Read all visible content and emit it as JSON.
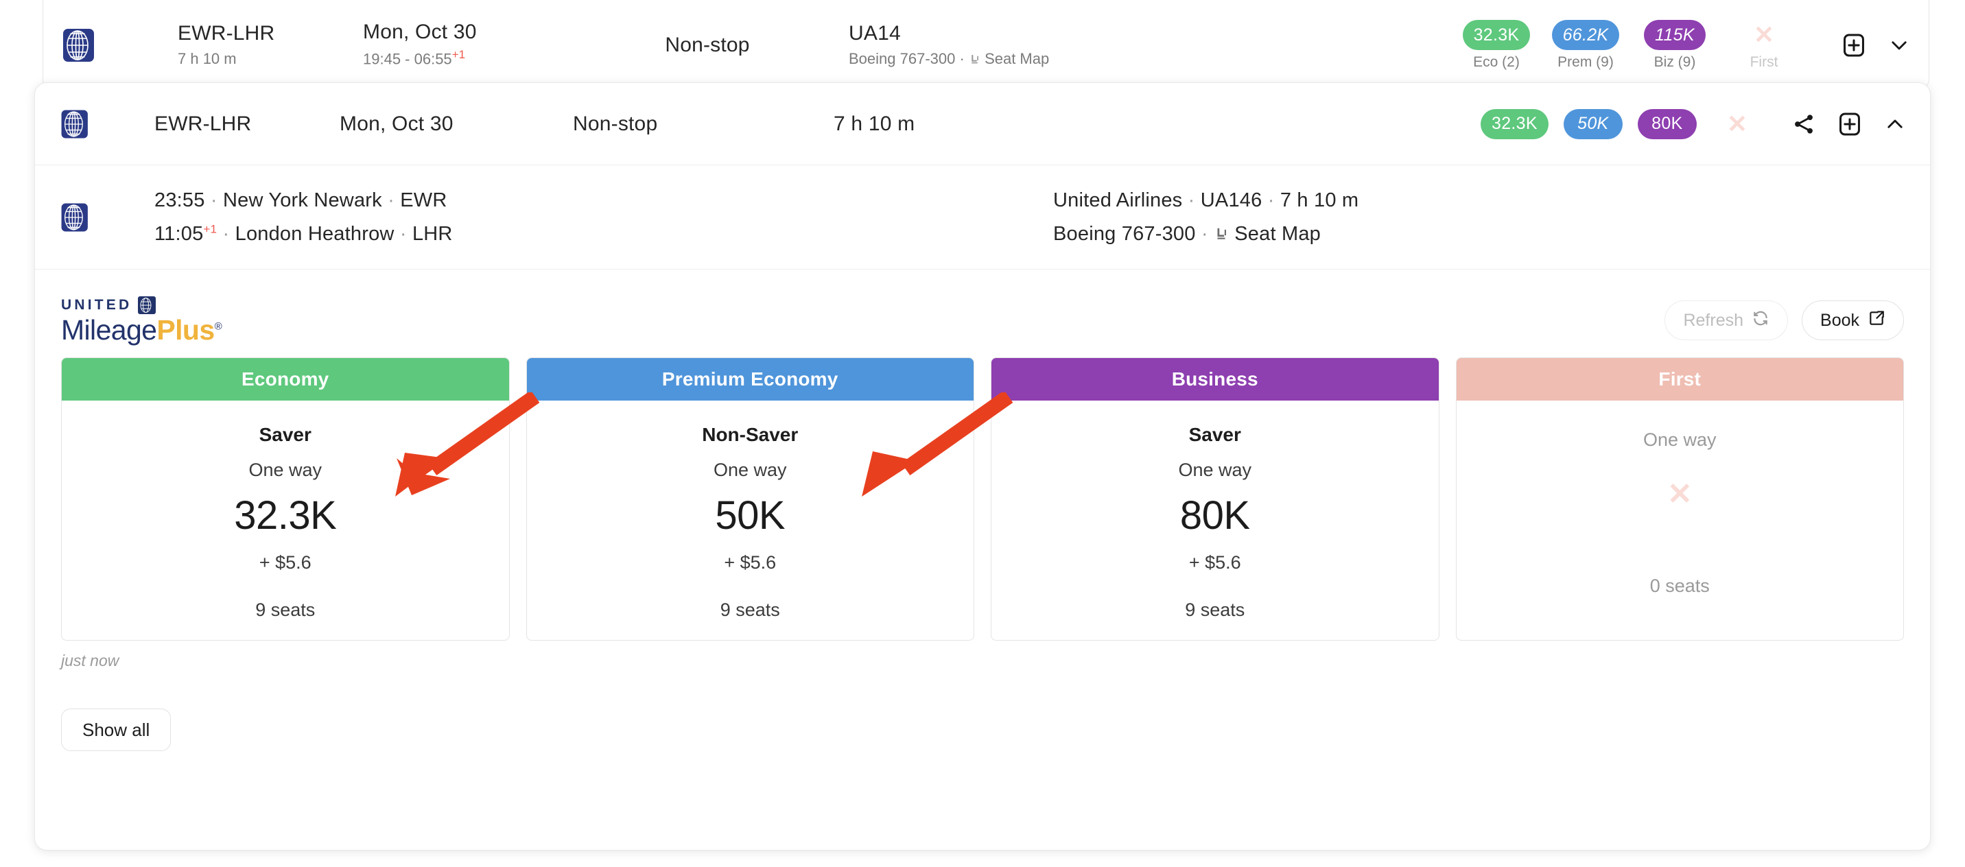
{
  "collapsed_row": {
    "airline_icon": "united-logo-icon",
    "route": "EWR-LHR",
    "duration": "7 h 10 m",
    "date": "Mon, Oct 30",
    "times": "19:45 - 06:55",
    "times_plus": "+1",
    "stops": "Non-stop",
    "flight_number": "UA14",
    "aircraft": "Boeing 767-300",
    "dot": "·",
    "seatmap_label": "Seat Map",
    "badges": [
      {
        "value": "32.3K",
        "label": "Eco (2)",
        "style": "eco",
        "italic": false,
        "available": true
      },
      {
        "value": "66.2K",
        "label": "Prem (9)",
        "style": "prem",
        "italic": true,
        "available": true
      },
      {
        "value": "115K",
        "label": "Biz (9)",
        "style": "biz",
        "italic": true,
        "available": true
      },
      {
        "value": "✕",
        "label": "First",
        "style": "none",
        "italic": false,
        "available": false
      }
    ],
    "add_icon": "plus-box-icon",
    "expand_icon": "chevron-down-icon"
  },
  "expanded_row": {
    "airline_icon": "united-logo-icon",
    "route": "EWR-LHR",
    "date": "Mon, Oct 30",
    "stops": "Non-stop",
    "duration": "7 h 10 m",
    "badges": [
      {
        "value": "32.3K",
        "style": "eco",
        "italic": false
      },
      {
        "value": "50K",
        "style": "prem",
        "italic": true
      },
      {
        "value": "80K",
        "style": "biz",
        "italic": false
      }
    ],
    "unavailable_mark": "✕",
    "share_icon": "share-icon",
    "add_icon": "plus-box-icon",
    "collapse_icon": "chevron-up-icon"
  },
  "segment": {
    "airline_icon": "united-logo-icon",
    "depart_time": "23:55",
    "depart_city": "New York Newark",
    "depart_code": "EWR",
    "arrive_time": "11:05",
    "arrive_plus": "+1",
    "arrive_city": "London Heathrow",
    "arrive_code": "LHR",
    "dot": "·",
    "airline_name": "United Airlines",
    "flight_number": "UA146",
    "duration": "7 h 10 m",
    "aircraft": "Boeing 767-300",
    "seatmap_label": "Seat Map"
  },
  "program": {
    "united_word": "UNITED",
    "mileage_word": "Mileage",
    "plus_word": "Plus",
    "registered": "®",
    "mark_icon": "united-globe-icon",
    "brand_navy": "#22336b",
    "brand_gold": "#f0b33c"
  },
  "actions": {
    "refresh_label": "Refresh",
    "refresh_icon": "refresh-icon",
    "book_label": "Book",
    "book_icon": "external-link-icon",
    "show_all_label": "Show all"
  },
  "fare_cards": [
    {
      "cabin": "Economy",
      "header_color": "#5ec87d",
      "tier": "Saver",
      "trip": "One way",
      "miles": "32.3K",
      "cash": "+ $5.6",
      "seats": "9 seats",
      "available": true
    },
    {
      "cabin": "Premium Economy",
      "header_color": "#4f95db",
      "tier": "Non-Saver",
      "trip": "One way",
      "miles": "50K",
      "cash": "+ $5.6",
      "seats": "9 seats",
      "available": true
    },
    {
      "cabin": "Business",
      "header_color": "#8e3fb0",
      "tier": "Saver",
      "trip": "One way",
      "miles": "80K",
      "cash": "+ $5.6",
      "seats": "9 seats",
      "available": true
    },
    {
      "cabin": "First",
      "header_color": "#efbdb2",
      "tier": "",
      "trip": "One way",
      "miles": "",
      "cash": "",
      "seats": "0 seats",
      "unavailable_mark": "✕",
      "available": false
    }
  ],
  "timestamp": "just now",
  "annotations": [
    {
      "name": "arrow-to-economy-saver",
      "color": "#e8401f"
    },
    {
      "name": "arrow-to-premium-non-saver",
      "color": "#e8401f"
    }
  ]
}
